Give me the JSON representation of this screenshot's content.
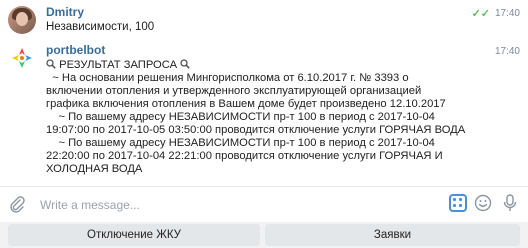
{
  "messages": [
    {
      "sender": "Dmitry",
      "time": "17:40",
      "status": "read",
      "text": "Независимости, 100"
    },
    {
      "sender": "portbelbot",
      "time": "17:40",
      "header": "РЕЗУЛЬТАТ ЗАПРОСА",
      "lines": [
        "  ~ На основании решения Мингорисполкома от 6.10.2017 г. № 3393 о включении отопления и утвержденного эксплуатирующей организацией графика включения отопления в Вашем доме будет произведено 12.10.2017",
        "    ~ По вашему адресу НЕЗАВИСИМОСТИ пр-т 100 в период с 2017-10-04 19:07:00 по 2017-10-05 03:50:00 проводится отключение услуги ГОРЯЧАЯ ВОДА",
        "    ~ По вашему адресу НЕЗАВИСИМОСТИ пр-т 100 в период с 2017-10-04 22:20:00 по 2017-10-04 22:21:00 проводится отключение услуги ГОРЯЧАЯ И ХОЛОДНАЯ ВОДА"
      ]
    }
  ],
  "composer": {
    "placeholder": "Write a message..."
  },
  "keyboard": {
    "buttons": [
      "Отключение ЖКУ",
      "Заявки"
    ]
  },
  "colors": {
    "sender": "#3a6d99",
    "check": "#5bbf5b",
    "accent": "#4a90d9"
  },
  "icons": [
    "paperclip-icon",
    "bot-keyboard-icon",
    "emoji-icon",
    "microphone-icon",
    "magnifier-icon",
    "double-check-icon"
  ]
}
